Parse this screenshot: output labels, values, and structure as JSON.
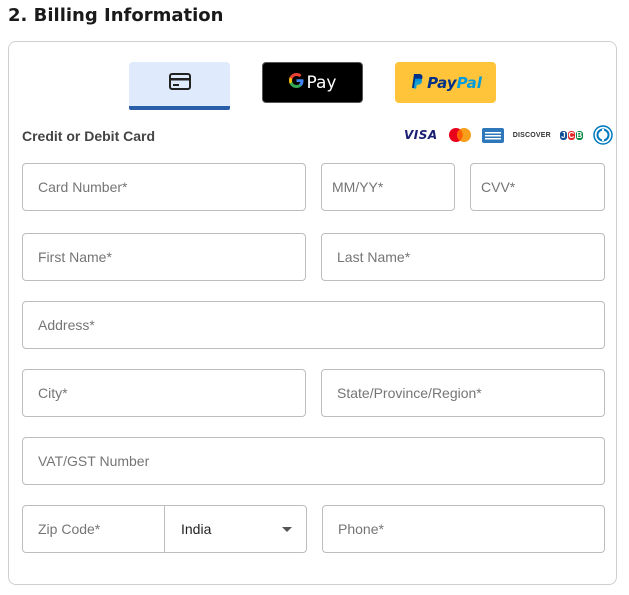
{
  "section": {
    "title": "2. Billing Information"
  },
  "payment_tabs": {
    "gpay_label": "Pay",
    "gpay_g": "G",
    "paypal_a": "Pay",
    "paypal_b": "Pal"
  },
  "card_section": {
    "label": "Credit or Debit Card",
    "brands": [
      "visa-icon",
      "mastercard-icon",
      "amex-icon",
      "discover-icon",
      "jcb-icon",
      "diners-icon"
    ],
    "visa_text": "VISA",
    "discover_text": "DISCOVER",
    "jcb_letters": [
      "J",
      "C",
      "B"
    ]
  },
  "fields": {
    "card_number": {
      "placeholder": "Card Number*",
      "value": ""
    },
    "expiry": {
      "placeholder": "MM/YY*",
      "value": ""
    },
    "cvv": {
      "placeholder": "CVV*",
      "value": ""
    },
    "first_name": {
      "placeholder": "First Name*",
      "value": ""
    },
    "last_name": {
      "placeholder": "Last Name*",
      "value": ""
    },
    "address": {
      "placeholder": "Address*",
      "value": ""
    },
    "city": {
      "placeholder": "City*",
      "value": ""
    },
    "state": {
      "placeholder": "State/Province/Region*",
      "value": ""
    },
    "vat": {
      "placeholder": "VAT/GST Number",
      "value": ""
    },
    "zip": {
      "placeholder": "Zip Code*",
      "value": ""
    },
    "country": {
      "selected": "India"
    },
    "phone": {
      "placeholder": "Phone*",
      "value": ""
    }
  },
  "colors": {
    "tab_active_bg": "#dfeafc",
    "tab_active_underline": "#2b5ea8",
    "paypal_bg": "#ffc439",
    "gpay_bg": "#000000"
  }
}
